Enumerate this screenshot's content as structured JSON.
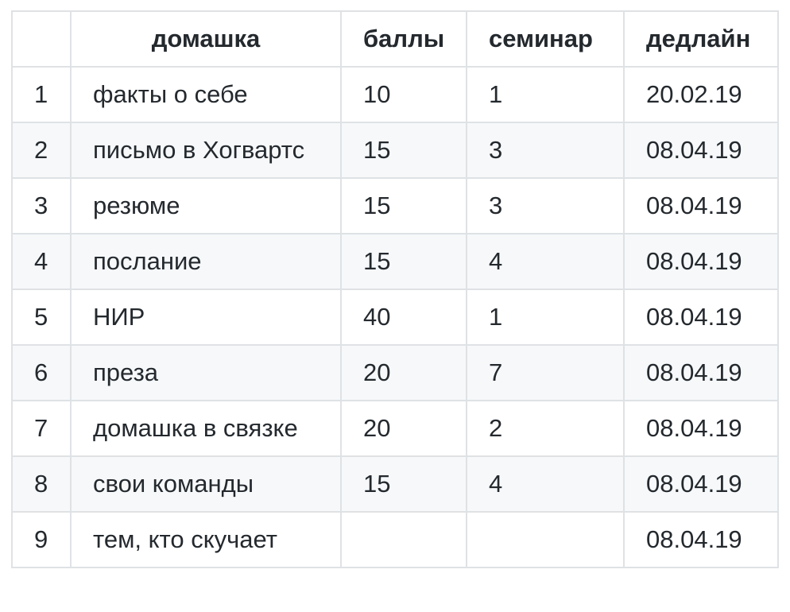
{
  "table": {
    "headers": [
      "",
      "домашка",
      "баллы",
      "семинар",
      "дедлайн"
    ],
    "rows": [
      [
        "1",
        "факты о себе",
        "10",
        "1",
        "20.02.19"
      ],
      [
        "2",
        "письмо в Хогвартс",
        "15",
        "3",
        "08.04.19"
      ],
      [
        "3",
        "резюме",
        "15",
        "3",
        "08.04.19"
      ],
      [
        "4",
        "послание",
        "15",
        "4",
        "08.04.19"
      ],
      [
        "5",
        "НИР",
        "40",
        "1",
        "08.04.19"
      ],
      [
        "6",
        "преза",
        "20",
        "7",
        "08.04.19"
      ],
      [
        "7",
        "домашка в связке",
        "20",
        "2",
        "08.04.19"
      ],
      [
        "8",
        "свои команды",
        "15",
        "4",
        "08.04.19"
      ],
      [
        "9",
        "тем, кто скучает",
        "",
        "",
        "08.04.19"
      ]
    ]
  },
  "colors": {
    "border": "#dfe2e5",
    "stripe": "#f6f8fa",
    "text": "#24292e"
  }
}
